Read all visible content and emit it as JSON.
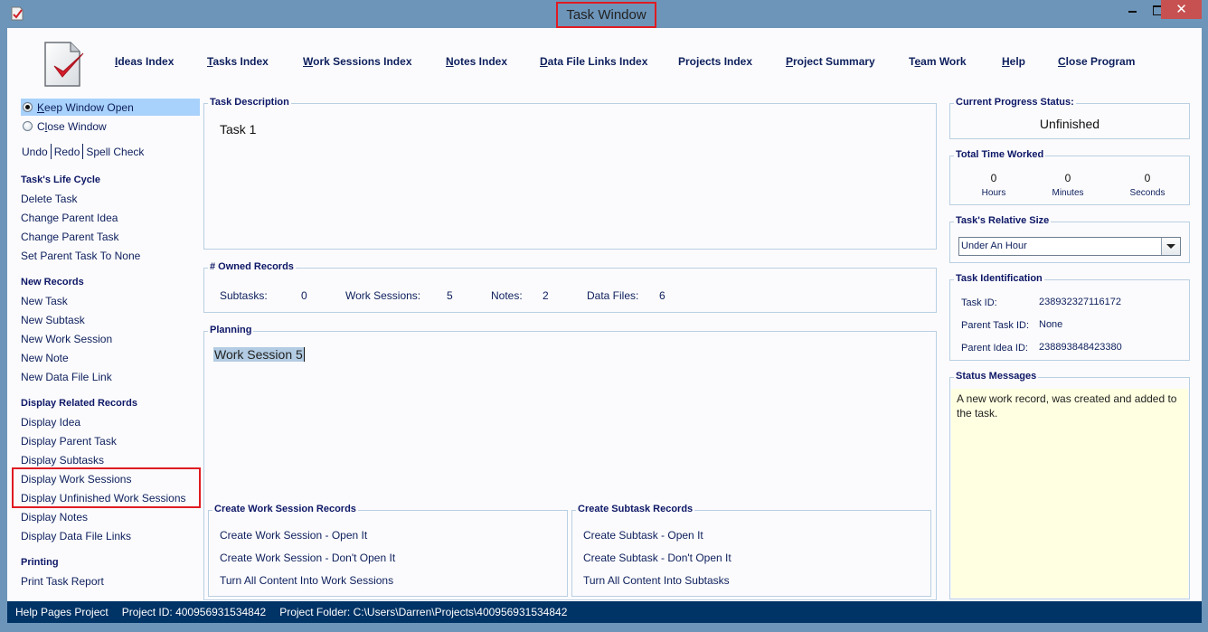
{
  "window": {
    "title": "Task Window",
    "close_glyph": "✕",
    "colors": {
      "titlebar": "#6d95b9",
      "close": "#c75050",
      "statusbar": "#003366",
      "highlight": "#e01b22"
    }
  },
  "topnav": [
    {
      "key": "I",
      "rest": "deas Index"
    },
    {
      "key": "T",
      "rest": "asks Index"
    },
    {
      "key": "W",
      "rest": "ork Sessions Index"
    },
    {
      "key": "N",
      "rest": "otes Index"
    },
    {
      "key": "D",
      "rest": "ata File Links Index"
    },
    {
      "key": "",
      "rest": "Projects Index"
    },
    {
      "key": "P",
      "rest": "roject Summary"
    },
    {
      "pre": "T",
      "key": "e",
      "rest": "am Work"
    },
    {
      "key": "H",
      "rest": "elp"
    },
    {
      "key": "C",
      "rest": "lose Program"
    }
  ],
  "sidebar": {
    "window_options": [
      {
        "pre": "",
        "key": "K",
        "rest": "eep Window Open",
        "selected": true
      },
      {
        "pre": "C",
        "key": "l",
        "rest": "ose Window",
        "selected": false
      }
    ],
    "edit_links": [
      "Undo",
      "Redo",
      "Spell Check"
    ],
    "sections": [
      {
        "heading": "Task's Life Cycle",
        "items": [
          "Delete Task",
          "Change Parent Idea",
          "Change Parent Task",
          "Set Parent Task To None"
        ]
      },
      {
        "heading": "New Records",
        "items": [
          "New Task",
          "New Subtask",
          "New Work Session",
          "New Note",
          "New Data File Link"
        ]
      },
      {
        "heading": "Display Related Records",
        "items": [
          "Display Idea",
          "Display Parent Task",
          "Display Subtasks",
          "Display Work Sessions",
          "Display Unfinished Work Sessions",
          "Display Notes",
          "Display Data File Links"
        ]
      },
      {
        "heading": "Printing",
        "items": [
          "Print Task Report"
        ]
      }
    ]
  },
  "main": {
    "description": {
      "title": "Task Description",
      "text": "Task 1"
    },
    "owned": {
      "title": "# Owned Records",
      "items": [
        {
          "label": "Subtasks:",
          "value": "0"
        },
        {
          "label": "Work Sessions:",
          "value": "5"
        },
        {
          "label": "Notes:",
          "value": "2"
        },
        {
          "label": "Data Files:",
          "value": "6"
        }
      ]
    },
    "planning": {
      "title": "Planning",
      "text": "Work Session 5"
    },
    "create_work_sessions": {
      "title": "Create Work Session Records",
      "items": [
        "Create Work Session - Open It",
        "Create Work Session - Don't Open It",
        "Turn All Content Into Work Sessions"
      ]
    },
    "create_subtasks": {
      "title": "Create Subtask Records",
      "items": [
        "Create Subtask - Open It",
        "Create Subtask - Don't Open It",
        "Turn All Content Into Subtasks"
      ]
    }
  },
  "right": {
    "progress": {
      "title": "Current Progress Status:",
      "value": "Unfinished"
    },
    "time": {
      "title": "Total Time Worked",
      "hours": "0",
      "hours_label": "Hours",
      "minutes": "0",
      "minutes_label": "Minutes",
      "seconds": "0",
      "seconds_label": "Seconds"
    },
    "size": {
      "title": "Task's Relative Size",
      "selected": "Under An Hour"
    },
    "ident": {
      "title": "Task Identification",
      "task_id_label": "Task ID:",
      "task_id": "238932327116172",
      "parent_task_label": "Parent Task ID:",
      "parent_task": "None",
      "parent_idea_label": "Parent Idea ID:",
      "parent_idea": "238893848423380"
    },
    "messages": {
      "title": "Status Messages",
      "text": "A new work record, was created and added to the task."
    }
  },
  "statusbar": {
    "project": "Help Pages Project",
    "project_id": "Project ID:  400956931534842",
    "folder": "Project Folder: C:\\Users\\Darren\\Projects\\400956931534842"
  }
}
